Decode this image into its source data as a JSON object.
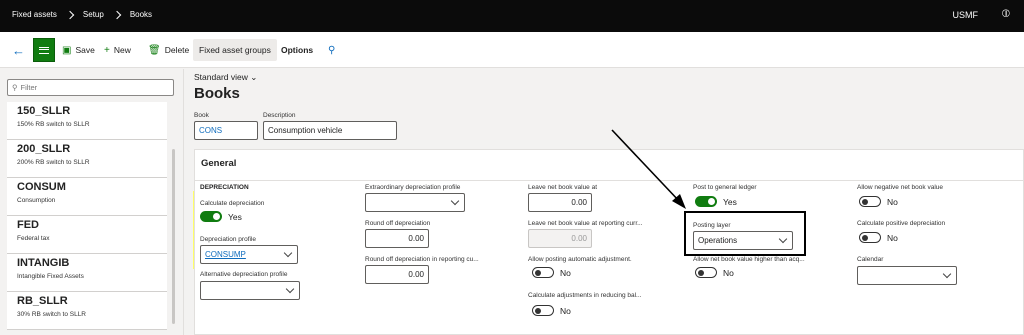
{
  "topbar": {
    "crumbs": [
      "Fixed assets",
      "Setup",
      "Books"
    ],
    "company": "USMF"
  },
  "actionbar": {
    "save": "Save",
    "new": "New",
    "delete": "Delete",
    "fixed_asset_groups": "Fixed asset groups",
    "options": "Options"
  },
  "leftpane": {
    "filter_placeholder": "Filter",
    "items": [
      {
        "code": "150_SLLR",
        "desc": "150% RB switch to SLLR"
      },
      {
        "code": "200_SLLR",
        "desc": "200% RB switch to SLLR"
      },
      {
        "code": "CONSUM",
        "desc": "Consumption"
      },
      {
        "code": "FED",
        "desc": "Federal tax"
      },
      {
        "code": "INTANGIB",
        "desc": "Intangible Fixed Assets"
      },
      {
        "code": "RB_SLLR",
        "desc": "30% RB switch to SLLR"
      }
    ]
  },
  "main": {
    "view": "Standard view",
    "title": "Books",
    "book_label": "Book",
    "book_value": "CONS",
    "description_label": "Description",
    "description_value": "Consumption vehicle",
    "section": "General",
    "depreciation_group": "DEPRECIATION",
    "calc_dep_label": "Calculate depreciation",
    "calc_dep_value": "Yes",
    "dep_profile_label": "Depreciation profile",
    "dep_profile_value": "CONSUMP",
    "alt_dep_profile_label": "Alternative depreciation profile",
    "extra_dep_label": "Extraordinary depreciation profile",
    "round_off_label": "Round off depreciation",
    "round_off_value": "0.00",
    "round_off_rep_label": "Round off depreciation in reporting cu...",
    "round_off_rep_value": "0.00",
    "leave_nbv_label": "Leave net book value at",
    "leave_nbv_value": "0.00",
    "leave_nbv_rep_label": "Leave net book value at reporting curr...",
    "leave_nbv_rep_value": "0.00",
    "allow_auto_adj_label": "Allow posting automatic adjustment.",
    "allow_auto_adj_value": "No",
    "calc_adj_label": "Calculate adjustments in reducing bal...",
    "calc_adj_value": "No",
    "post_gl_label": "Post to general ledger",
    "post_gl_value": "Yes",
    "posting_layer_label": "Posting layer",
    "posting_layer_value": "Operations",
    "allow_nbv_higher_label": "Allow net book value higher than acq...",
    "allow_nbv_higher_value": "No",
    "allow_neg_label": "Allow negative net book value",
    "allow_neg_value": "No",
    "calc_pos_label": "Calculate positive depreciation",
    "calc_pos_value": "No",
    "calendar_label": "Calendar"
  }
}
